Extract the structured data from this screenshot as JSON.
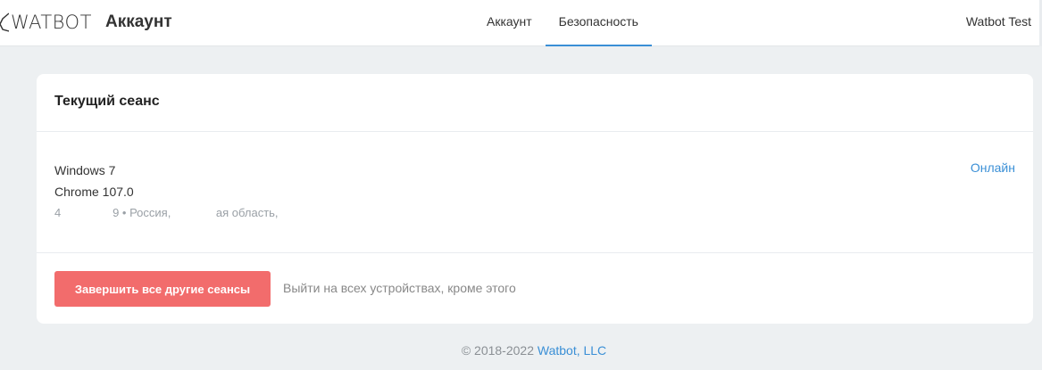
{
  "header": {
    "logo_text": "WATBOT",
    "app_title": "Аккаунт",
    "tabs": [
      {
        "label": "Аккаунт",
        "active": false
      },
      {
        "label": "Безопасность",
        "active": true
      }
    ],
    "user_name": "Watbot Test"
  },
  "current_session": {
    "title": "Текущий сеанс",
    "os": "Windows 7",
    "browser": "Chrome 107.0",
    "meta_prefix": "4",
    "meta_mid": "9 • Россия,",
    "meta_region": "ая область,",
    "status": "Онлайн"
  },
  "actions": {
    "end_all_label": "Завершить все другие сеансы",
    "end_all_hint": "Выйти на всех устройствах, кроме этого"
  },
  "footer": {
    "copyright": "© 2018-2022",
    "company": "Watbot, LLC"
  },
  "colors": {
    "accent": "#3a8fd6",
    "danger_button": "#f26c6c",
    "page_bg": "#edf0f2"
  }
}
